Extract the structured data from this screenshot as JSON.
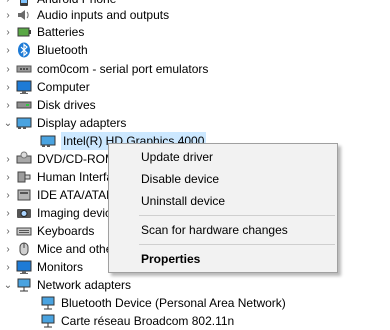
{
  "tree": {
    "items": [
      {
        "label": "Android Phone",
        "expanded": false,
        "icon": "phone-icon"
      },
      {
        "label": "Audio inputs and outputs",
        "expanded": false,
        "icon": "speaker-icon"
      },
      {
        "label": "Batteries",
        "expanded": false,
        "icon": "battery-icon"
      },
      {
        "label": "Bluetooth",
        "expanded": false,
        "icon": "bluetooth-icon"
      },
      {
        "label": "com0com - serial port emulators",
        "expanded": false,
        "icon": "port-icon"
      },
      {
        "label": "Computer",
        "expanded": false,
        "icon": "monitor-icon"
      },
      {
        "label": "Disk drives",
        "expanded": false,
        "icon": "disk-icon"
      },
      {
        "label": "Display adapters",
        "expanded": true,
        "icon": "display-adapter-icon"
      },
      {
        "label": "Intel(R) HD Graphics 4000",
        "child": true,
        "selected": true,
        "icon": "display-adapter-icon"
      },
      {
        "label": "DVD/CD-ROM drives",
        "expanded": false,
        "icon": "dvd-icon"
      },
      {
        "label": "Human Interface Devices",
        "expanded": false,
        "icon": "hid-icon"
      },
      {
        "label": "IDE ATA/ATAPI controllers",
        "expanded": false,
        "icon": "ide-icon"
      },
      {
        "label": "Imaging devices",
        "expanded": false,
        "icon": "camera-icon"
      },
      {
        "label": "Keyboards",
        "expanded": false,
        "icon": "keyboard-icon"
      },
      {
        "label": "Mice and other pointing devices",
        "expanded": false,
        "icon": "mouse-icon"
      },
      {
        "label": "Monitors",
        "expanded": false,
        "icon": "monitor-icon"
      },
      {
        "label": "Network adapters",
        "expanded": true,
        "icon": "network-icon"
      },
      {
        "label": "Bluetooth Device (Personal Area Network)",
        "child": true,
        "icon": "network-icon"
      },
      {
        "label": "Carte réseau Broadcom 802.11n",
        "child": true,
        "icon": "network-icon"
      }
    ]
  },
  "context_menu": {
    "update": "Update driver",
    "disable": "Disable device",
    "uninstall": "Uninstall device",
    "scan": "Scan for hardware changes",
    "properties": "Properties"
  },
  "colors": {
    "selection": "#cce8ff",
    "menu_bg": "#f2f2f2",
    "icon_blue": "#1e7bd6"
  }
}
